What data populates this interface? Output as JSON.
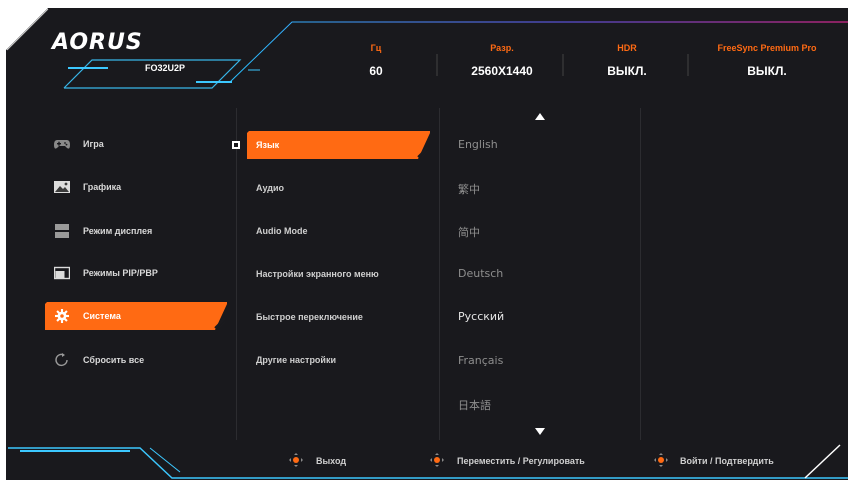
{
  "brand": {
    "logo_text": "AORUS",
    "model": "FO32U2P"
  },
  "status": [
    {
      "label": "Гц",
      "value": "60"
    },
    {
      "label": "Разр.",
      "value": "2560X1440"
    },
    {
      "label": "HDR",
      "value": "ВЫКЛ."
    },
    {
      "label": "FreeSync Premium Pro",
      "value": "ВЫКЛ."
    }
  ],
  "categories": [
    {
      "label": "Игра",
      "icon": "gamepad-icon"
    },
    {
      "label": "Графика",
      "icon": "picture-icon"
    },
    {
      "label": "Режим дисплея",
      "icon": "display-mode-icon"
    },
    {
      "label": "Режимы PIP/PBP",
      "icon": "pip-icon"
    },
    {
      "label": "Система",
      "icon": "gear-icon",
      "selected": true
    },
    {
      "label": "Сбросить все",
      "icon": "reset-icon"
    }
  ],
  "submenu": [
    {
      "label": "Язык",
      "selected": true
    },
    {
      "label": "Аудио"
    },
    {
      "label": "Audio Mode"
    },
    {
      "label": "Настройки экранного меню"
    },
    {
      "label": "Быстрое переключение"
    },
    {
      "label": "Другие настройки"
    }
  ],
  "languages": [
    {
      "label": "English"
    },
    {
      "label": "繁中"
    },
    {
      "label": "简中"
    },
    {
      "label": "Deutsch"
    },
    {
      "label": "Русский",
      "selected": true
    },
    {
      "label": "Français"
    },
    {
      "label": "日本語"
    }
  ],
  "footer": {
    "exit": "Выход",
    "move": "Переместить / Регулировать",
    "confirm": "Войти / Подтвердить"
  },
  "colors": {
    "accent": "#ff6a13",
    "background": "#19191d",
    "text": "#d8d8d8"
  }
}
